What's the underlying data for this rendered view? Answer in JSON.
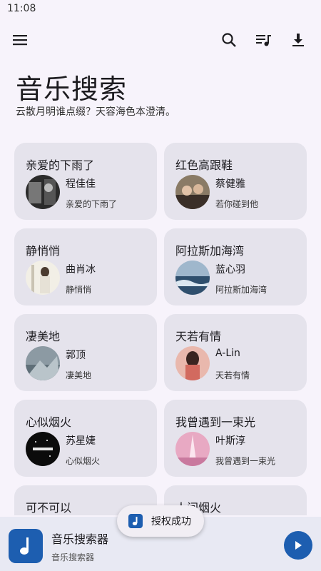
{
  "status_bar": {
    "time": "11:08"
  },
  "header": {
    "title": "音乐搜索",
    "subtitle": "云散月明谁点缀？天容海色本澄清。"
  },
  "toolbar": {
    "icons": [
      "menu-icon",
      "search-icon",
      "playlist-icon",
      "download-icon"
    ]
  },
  "cards": [
    {
      "title": "亲爱的下雨了",
      "artist": "程佳佳",
      "song": "亲爱的下雨了"
    },
    {
      "title": "红色高跟鞋",
      "artist": "蔡健雅",
      "song": "若你碰到他"
    },
    {
      "title": "静悄悄",
      "artist": "曲肖冰",
      "song": "静悄悄"
    },
    {
      "title": "阿拉斯加海湾",
      "artist": "蓝心羽",
      "song": "阿拉斯加海湾"
    },
    {
      "title": "凄美地",
      "artist": "郭顶",
      "song": "凄美地"
    },
    {
      "title": "天若有情",
      "artist": "A-Lin",
      "song": "天若有情"
    },
    {
      "title": "心似烟火",
      "artist": "苏星婕",
      "song": "心似烟火"
    },
    {
      "title": "我曾遇到一束光",
      "artist": "叶斯淳",
      "song": "我曾遇到一束光"
    },
    {
      "title": "可不可以",
      "artist": "",
      "song": ""
    },
    {
      "title": "人间烟火",
      "artist": "",
      "song": ""
    }
  ],
  "player": {
    "title": "音乐搜索器",
    "subtitle": "音乐搜索器"
  },
  "toast": {
    "text": "授权成功"
  },
  "colors": {
    "accent": "#1d5eb0",
    "card_bg": "#e5e3ec",
    "page_bg": "#f7f3fb"
  }
}
